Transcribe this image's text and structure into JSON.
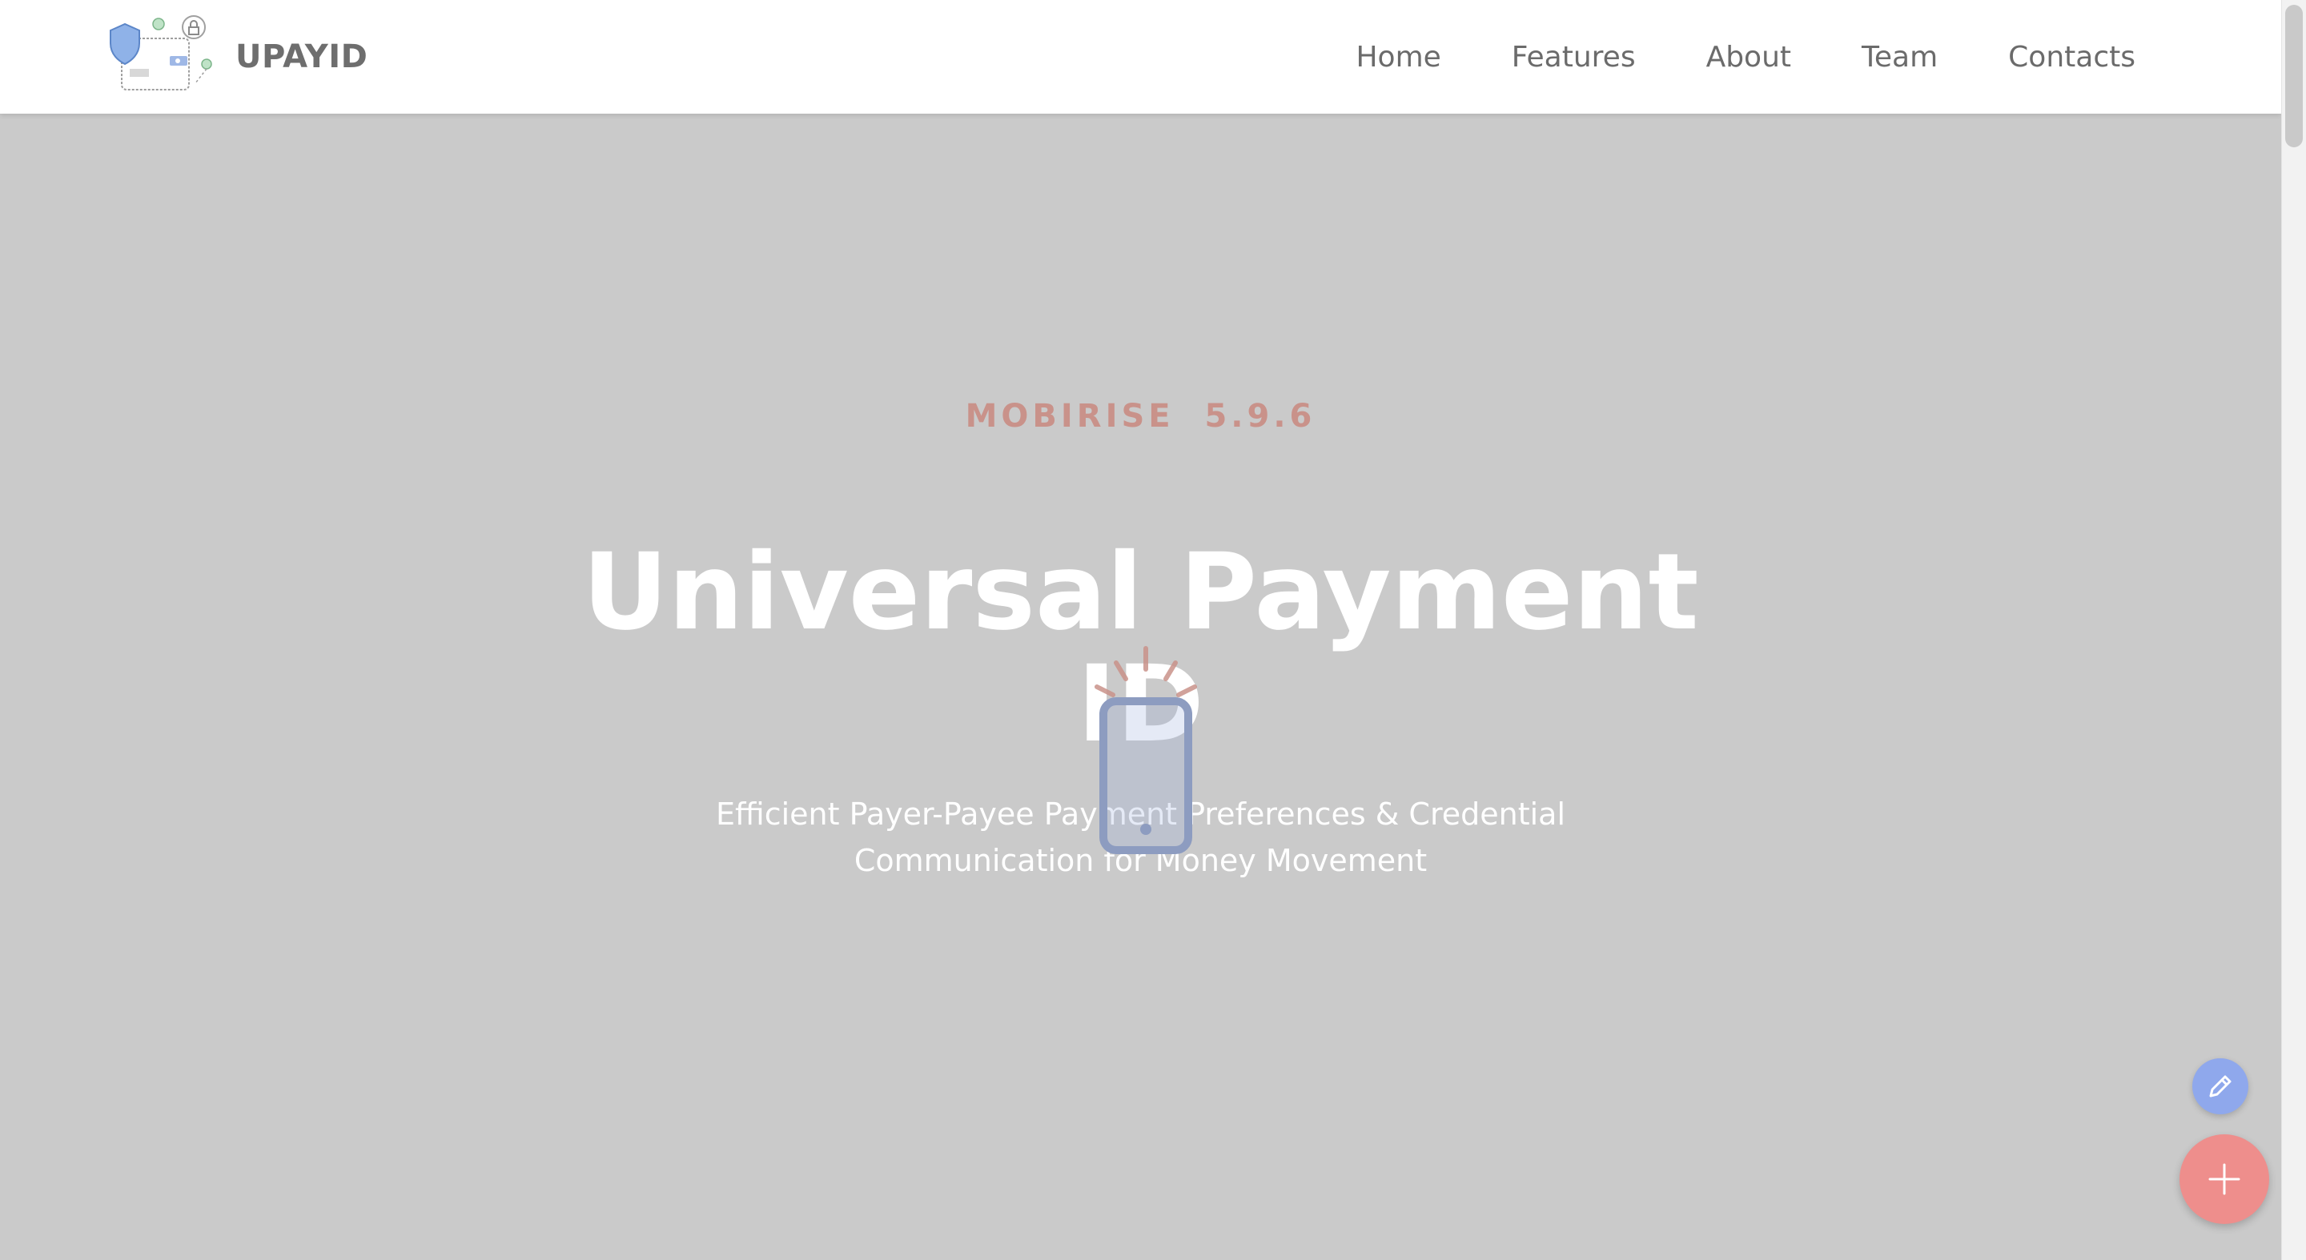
{
  "navbar": {
    "brand_name": "UPAYID",
    "logo_icon": "wallet-shield-logo-icon",
    "links": [
      {
        "label": "Home"
      },
      {
        "label": "Features"
      },
      {
        "label": "About"
      },
      {
        "label": "Team"
      },
      {
        "label": "Contacts"
      }
    ]
  },
  "hero": {
    "eyebrow": "MOBIRISE  5.9.6",
    "title": "Universal Payment ID",
    "subtitle": "Efficient Payer-Payee Payment Preferences & Credential Communication for Money Movement",
    "overlay_icon": "phone-loading-icon"
  },
  "fabs": {
    "edit_icon": "pencil-icon",
    "add_icon": "plus-icon"
  },
  "colors": {
    "hero_background": "#cacaca",
    "eyebrow": "#c9928a",
    "nav_text": "#6b6b6b",
    "fab_edit": "#8fa8ec",
    "fab_add": "#ee8e8c"
  }
}
